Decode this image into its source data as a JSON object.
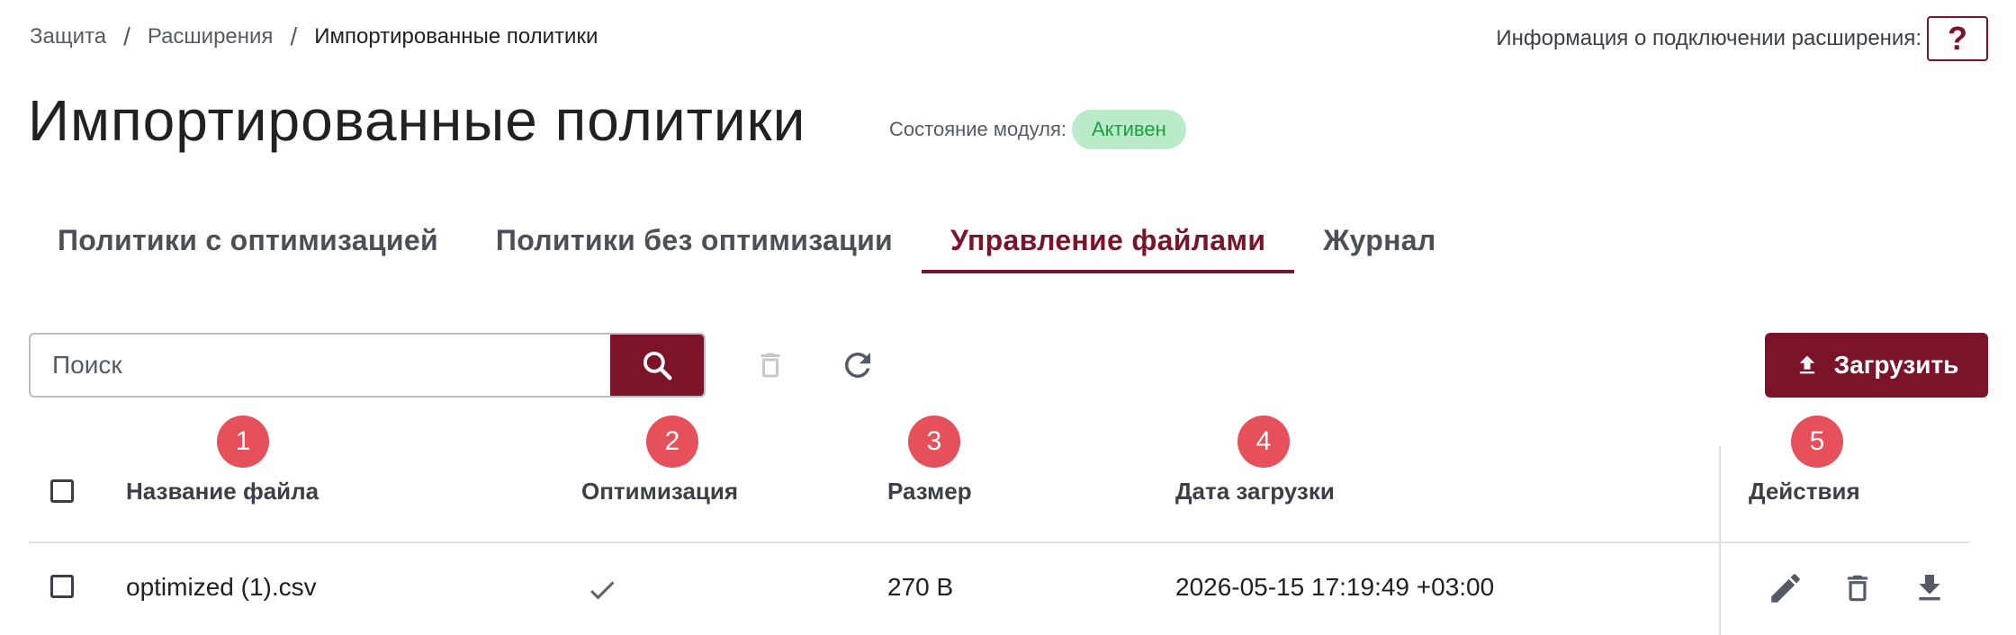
{
  "breadcrumb": {
    "items": [
      "Защита",
      "Расширения",
      "Импортированные политики"
    ],
    "separator": "/"
  },
  "connection_info": {
    "label": "Информация о подключении расширения:",
    "help_button": "?"
  },
  "page_title": "Импортированные политики",
  "module_state": {
    "label": "Состояние модуля:",
    "value": "Активен"
  },
  "tabs": [
    {
      "label": "Политики с оптимизацией",
      "active": false
    },
    {
      "label": "Политики без оптимизации",
      "active": false
    },
    {
      "label": "Управление файлами",
      "active": true
    },
    {
      "label": "Журнал",
      "active": false
    }
  ],
  "toolbar": {
    "search_placeholder": "Поиск",
    "search_icon": "search-icon",
    "delete_icon": "trash-icon",
    "refresh_icon": "refresh-icon",
    "upload_label": "Загрузить",
    "upload_icon": "upload-icon"
  },
  "markers": [
    "1",
    "2",
    "3",
    "4",
    "5"
  ],
  "table": {
    "columns": [
      "Название файла",
      "Оптимизация",
      "Размер",
      "Дата загрузки",
      "Действия"
    ],
    "rows": [
      {
        "file_name": "optimized (1).csv",
        "optimized": true,
        "size": "270 B",
        "upload_date": "2026-05-15 17:19:49 +03:00",
        "actions": [
          "edit-icon",
          "trash-icon",
          "download-icon"
        ]
      }
    ]
  },
  "colors": {
    "accent": "#7b1429",
    "badge_bg": "#b9ebc8",
    "badge_text": "#1e9e43",
    "marker": "#e5505a"
  }
}
